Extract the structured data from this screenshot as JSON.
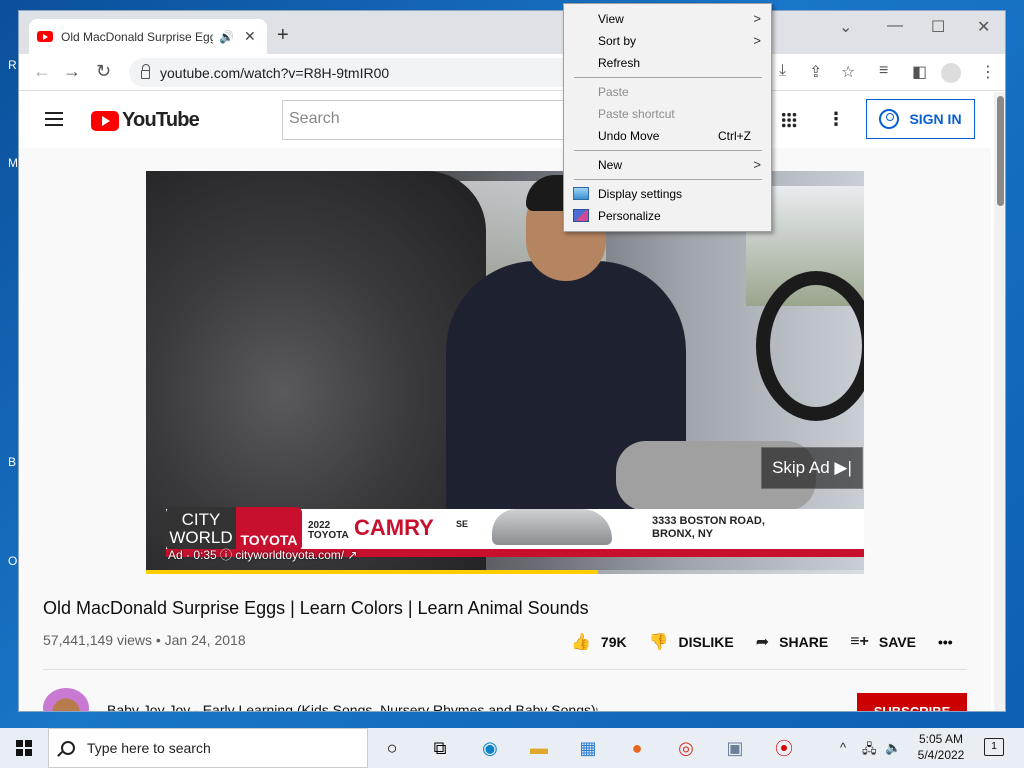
{
  "desktop": {
    "edge_letters": [
      "R",
      "M",
      "B",
      "O"
    ]
  },
  "browser": {
    "tab": {
      "title": "Old MacDonald Surprise Eggs",
      "audio_icon": "speaker-icon",
      "close_label": "✕"
    },
    "new_tab_label": "+",
    "window_controls": {
      "menu": "⌄",
      "minimize": "—",
      "maximize": "☐",
      "close": "✕"
    },
    "nav": {
      "back": "←",
      "forward": "→",
      "reload": "↻"
    },
    "url": "youtube.com/watch?v=R8H-9tmIR00"
  },
  "youtube": {
    "logo_text": "YouTube",
    "search_placeholder": "Search",
    "sign_in_label": "SIGN IN",
    "video": {
      "skip_ad_label": "Skip Ad ▶|",
      "ad_info": "Ad · 0:35 ⓘ  cityworldtoyota.com/ ↗",
      "progress_fraction": 0.63,
      "banner": {
        "city_world": "CITY WORLD",
        "toyota": "TOYOTA",
        "model_year": "2022",
        "model_make": "TOYOTA",
        "model": "CAMRY",
        "trim": "SE",
        "address_line1": "3333 BOSTON ROAD,",
        "address_line2": "BRONX, NY"
      }
    },
    "title": "Old MacDonald Surprise Eggs | Learn Colors | Learn Animal Sounds",
    "meta": "57,441,149 views • Jan 24, 2018",
    "actions": {
      "like_count": "79K",
      "dislike_label": "DISLIKE",
      "share_label": "SHARE",
      "save_label": "SAVE",
      "more_label": "•••"
    },
    "channel_name": "Baby Joy Joy - Early Learning (Kids Songs, Nursery Rhymes and Baby Songs)",
    "subscribe_label": "SUBSCRIBE"
  },
  "context_menu": {
    "items": [
      {
        "label": "View",
        "submenu": true,
        "enabled": true
      },
      {
        "label": "Sort by",
        "submenu": true,
        "enabled": true
      },
      {
        "label": "Refresh",
        "enabled": true
      },
      {
        "label": "Paste",
        "enabled": false
      },
      {
        "label": "Paste shortcut",
        "enabled": false
      },
      {
        "label": "Undo Move",
        "shortcut": "Ctrl+Z",
        "enabled": true
      },
      {
        "label": "New",
        "submenu": true,
        "enabled": true
      },
      {
        "label": "Display settings",
        "icon": "display-icon",
        "enabled": true
      },
      {
        "label": "Personalize",
        "icon": "personalize-icon",
        "enabled": true
      }
    ]
  },
  "taskbar": {
    "search_placeholder": "Type here to search",
    "time": "5:05 AM",
    "date": "5/4/2022",
    "notification_count": "1"
  }
}
